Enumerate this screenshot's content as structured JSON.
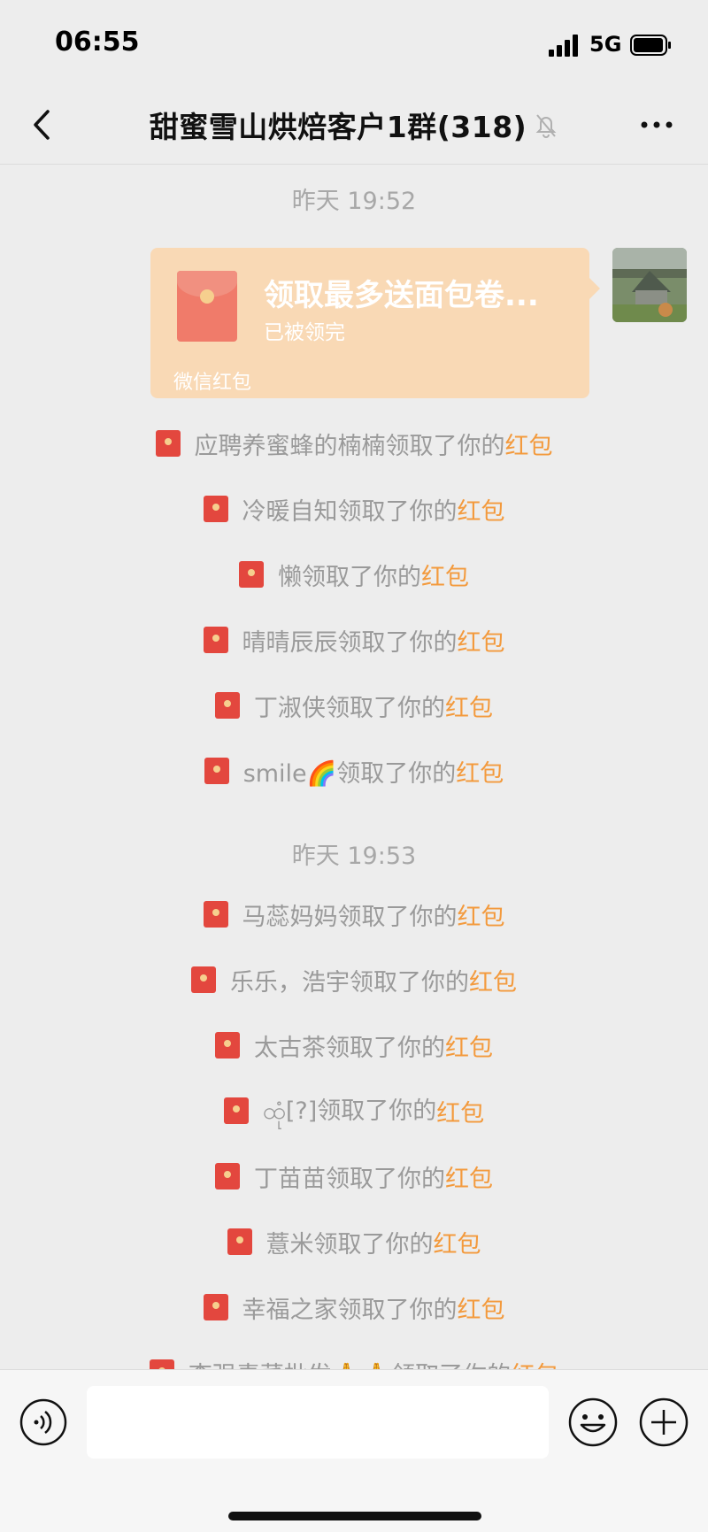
{
  "status": {
    "time": "06:55",
    "network": "5G"
  },
  "header": {
    "title": "甜蜜雪山烘焙客户1群(318)",
    "back_icon": "chevron-left-icon",
    "more_icon": "more-dots-icon",
    "mute_icon": "mute-bell-icon"
  },
  "chat": {
    "timestamps": [
      "昨天 19:52",
      "昨天 19:53"
    ],
    "red_packet": {
      "title": "领取最多送面包卷...",
      "status": "已被领完",
      "label": "微信红包"
    },
    "claims_group1": [
      {
        "name": "应聘养蜜蜂的楠楠",
        "suffix": "领取了你的",
        "link": "红包"
      },
      {
        "name": "冷暖自知",
        "suffix": "领取了你的",
        "link": "红包"
      },
      {
        "name": "懒",
        "suffix": "领取了你的",
        "link": "红包"
      },
      {
        "name": "晴晴辰辰",
        "suffix": "领取了你的",
        "link": "红包"
      },
      {
        "name": "丁淑侠",
        "suffix": "领取了你的",
        "link": "红包"
      },
      {
        "name": "smile🌈",
        "suffix": "领取了你的",
        "link": "红包"
      }
    ],
    "claims_group2": [
      {
        "name": "马蕊妈妈",
        "suffix": "领取了你的",
        "link": "红包"
      },
      {
        "name": "乐乐，浩宇",
        "suffix": "领取了你的",
        "link": "红包"
      },
      {
        "name": "太古茶",
        "suffix": "领取了你的",
        "link": "红包"
      },
      {
        "name": "ထုံ[?]",
        "suffix": "领取了你的",
        "link": "红包"
      },
      {
        "name": "丁苗苗",
        "suffix": "领取了你的",
        "link": "红包"
      },
      {
        "name": "薏米",
        "suffix": "领取了你的",
        "link": "红包"
      },
      {
        "name": "幸福之家",
        "suffix": "领取了你的",
        "link": "红包"
      },
      {
        "name": "李强毒菜批发🙏🙏",
        "suffix": "领取了你的",
        "link": "红包"
      }
    ]
  },
  "input": {
    "placeholder": "",
    "value": ""
  },
  "colors": {
    "background": "#ededed",
    "red_packet_bubble": "#f9d9b5",
    "envelope": "#e3473e",
    "link": "#f39a3d"
  }
}
